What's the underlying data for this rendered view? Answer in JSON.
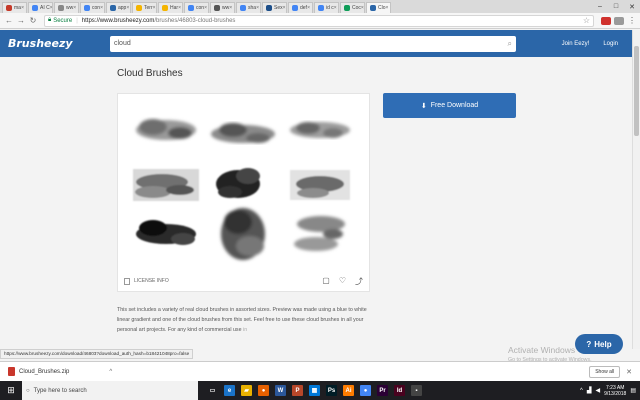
{
  "browser": {
    "tabs": [
      {
        "label": "ma",
        "color": "#c53929"
      },
      {
        "label": "AI C",
        "color": "#4285f4"
      },
      {
        "label": "ww",
        "color": "#888888"
      },
      {
        "label": "con",
        "color": "#4285f4"
      },
      {
        "label": "app",
        "color": "#2b66a8"
      },
      {
        "label": "Terr",
        "color": "#f4b400"
      },
      {
        "label": "Har",
        "color": "#f4b400"
      },
      {
        "label": "con",
        "color": "#4285f4"
      },
      {
        "label": "ww",
        "color": "#555555"
      },
      {
        "label": "sha",
        "color": "#4285f4"
      },
      {
        "label": "Sex",
        "color": "#1d4e89"
      },
      {
        "label": "def",
        "color": "#4285f4"
      },
      {
        "label": "id c",
        "color": "#4285f4"
      },
      {
        "label": "Coc",
        "color": "#0f9d58"
      },
      {
        "label": "Clo",
        "color": "#2b66a8"
      }
    ],
    "active_tab_index": 14,
    "address": {
      "secure_label": "Secure",
      "domain": "https://www.brusheezy.com",
      "path": "/brushes/46803-cloud-brushes"
    }
  },
  "site": {
    "logo": "Brusheezy",
    "search_value": "cloud",
    "links": [
      "Join Eezy!",
      "Login"
    ]
  },
  "page": {
    "title": "Cloud Brushes",
    "download_label": "Free Download",
    "license_info": "LICENSE INFO",
    "description": "This set includes a variety of real cloud brushes in assorted sizes. Preview was made using a blue to white linear gradient and one of the cloud brushes from this set. Feel free to use these cloud brushes in all your personal art projects. For any kind of commercial use",
    "description_faded": "in"
  },
  "help_label": "Help",
  "watermark": {
    "title": "Activate Windows",
    "subtitle": "Go to Settings to activate Windows."
  },
  "status_url": "https://www.brusheezy.com/download/46803?download_auth_hash=b18421048pro=false",
  "downloads": {
    "file": "Cloud_Brushes.zip",
    "show_all": "Show all"
  },
  "taskbar": {
    "search_placeholder": "Type here to search",
    "apps": [
      {
        "name": "task-view",
        "glyph": "▭",
        "color": "transparent"
      },
      {
        "name": "edge",
        "glyph": "e",
        "color": "#1a73c8"
      },
      {
        "name": "file-explorer",
        "glyph": "▰",
        "color": "#e8b100"
      },
      {
        "name": "firefox",
        "glyph": "●",
        "color": "#e66000"
      },
      {
        "name": "word",
        "glyph": "W",
        "color": "#2b579a"
      },
      {
        "name": "powerpoint",
        "glyph": "P",
        "color": "#b7472a"
      },
      {
        "name": "store",
        "glyph": "▦",
        "color": "#0078d7"
      },
      {
        "name": "photoshop",
        "glyph": "Ps",
        "color": "#001d26"
      },
      {
        "name": "illustrator",
        "glyph": "Ai",
        "color": "#ff7c00"
      },
      {
        "name": "chrome",
        "glyph": "●",
        "color": "#4285f4"
      },
      {
        "name": "premiere",
        "glyph": "Pr",
        "color": "#2a0034"
      },
      {
        "name": "indesign",
        "glyph": "Id",
        "color": "#49021f"
      },
      {
        "name": "media",
        "glyph": "▪",
        "color": "#444444"
      }
    ],
    "time": "7:23 AM",
    "date": "9/13/2018"
  }
}
